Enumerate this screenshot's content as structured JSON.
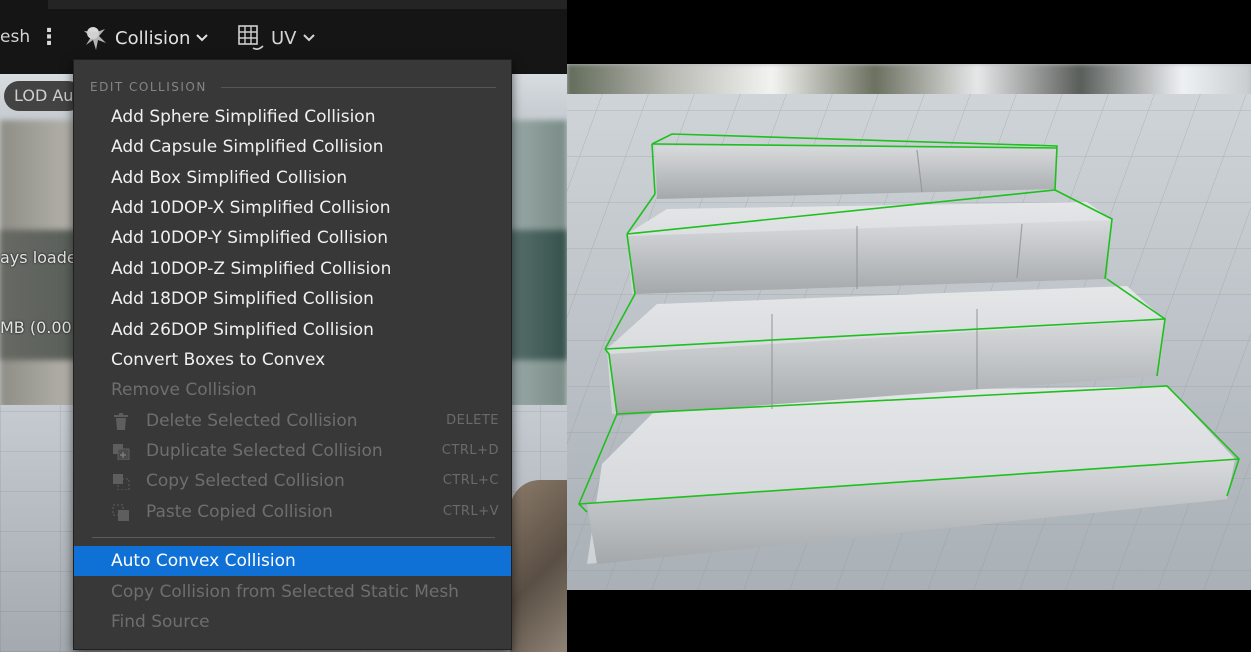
{
  "toolbar": {
    "partial_left_label": "esh",
    "collision_label": "Collision",
    "uv_label": "UV",
    "kebab_glyph": "⋮"
  },
  "viewport_left": {
    "lod_label": "LOD Au",
    "text_line_1": "ays loade",
    "text_line_2": "MB (0.00 I"
  },
  "collision_menu": {
    "section_header": "EDIT COLLISION",
    "items": [
      {
        "label": "Add Sphere Simplified Collision",
        "enabled": true
      },
      {
        "label": "Add Capsule Simplified Collision",
        "enabled": true
      },
      {
        "label": "Add Box Simplified Collision",
        "enabled": true
      },
      {
        "label": "Add 10DOP-X Simplified Collision",
        "enabled": true
      },
      {
        "label": "Add 10DOP-Y Simplified Collision",
        "enabled": true
      },
      {
        "label": "Add 10DOP-Z Simplified Collision",
        "enabled": true
      },
      {
        "label": "Add 18DOP Simplified Collision",
        "enabled": true
      },
      {
        "label": "Add 26DOP Simplified Collision",
        "enabled": true
      },
      {
        "label": "Convert Boxes to Convex",
        "enabled": true
      },
      {
        "label": "Remove Collision",
        "enabled": false
      },
      {
        "label": "Delete Selected Collision",
        "shortcut": "DELETE",
        "icon": "trash-icon",
        "enabled": false
      },
      {
        "label": "Duplicate Selected Collision",
        "shortcut": "CTRL+D",
        "icon": "duplicate-icon",
        "enabled": false
      },
      {
        "label": "Copy Selected Collision",
        "shortcut": "CTRL+C",
        "icon": "copy-icon",
        "enabled": false
      },
      {
        "label": "Paste Copied Collision",
        "shortcut": "CTRL+V",
        "icon": "paste-icon",
        "enabled": false
      },
      {
        "label": "Auto Convex Collision",
        "enabled": true,
        "highlighted": true
      },
      {
        "label": "Copy Collision from Selected Static Mesh",
        "enabled": false
      },
      {
        "label": "Find Source",
        "enabled": false
      }
    ]
  },
  "colors": {
    "menu_bg": "#383838",
    "highlight": "#0f70d6",
    "collision_wire": "#1ec01e",
    "disabled_text": "#6e6e6e"
  }
}
